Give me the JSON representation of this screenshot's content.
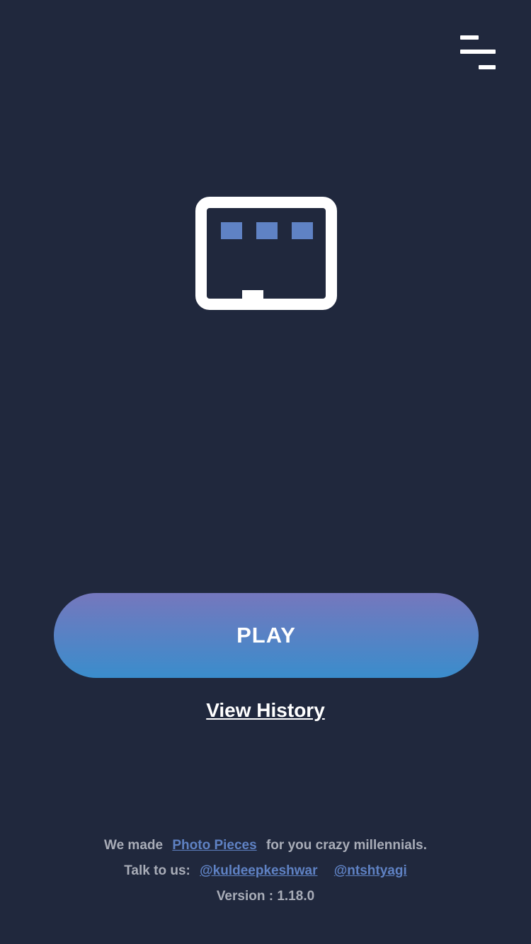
{
  "header": {
    "menu_icon": "menu-icon"
  },
  "logo": {
    "icon": "photo-pieces-logo-icon",
    "colors": {
      "frame": "#ffffff",
      "squares": "#5f82c4"
    }
  },
  "play_button": {
    "label": "PLAY",
    "gradient_top": "#7577bd",
    "gradient_bottom": "#3a8dcc"
  },
  "history": {
    "label": "View History"
  },
  "footer": {
    "line1_prefix": "We made",
    "app_link": "Photo Pieces",
    "line1_suffix": "for you crazy millennials.",
    "line2_prefix": "Talk to us:",
    "handle1": "@kuldeepkeshwar",
    "handle2": "@ntshtyagi",
    "version": "Version : 1.18.0"
  },
  "colors": {
    "background": "#20283d",
    "link": "#5f82c4",
    "footer_text": "#a9adb8"
  }
}
